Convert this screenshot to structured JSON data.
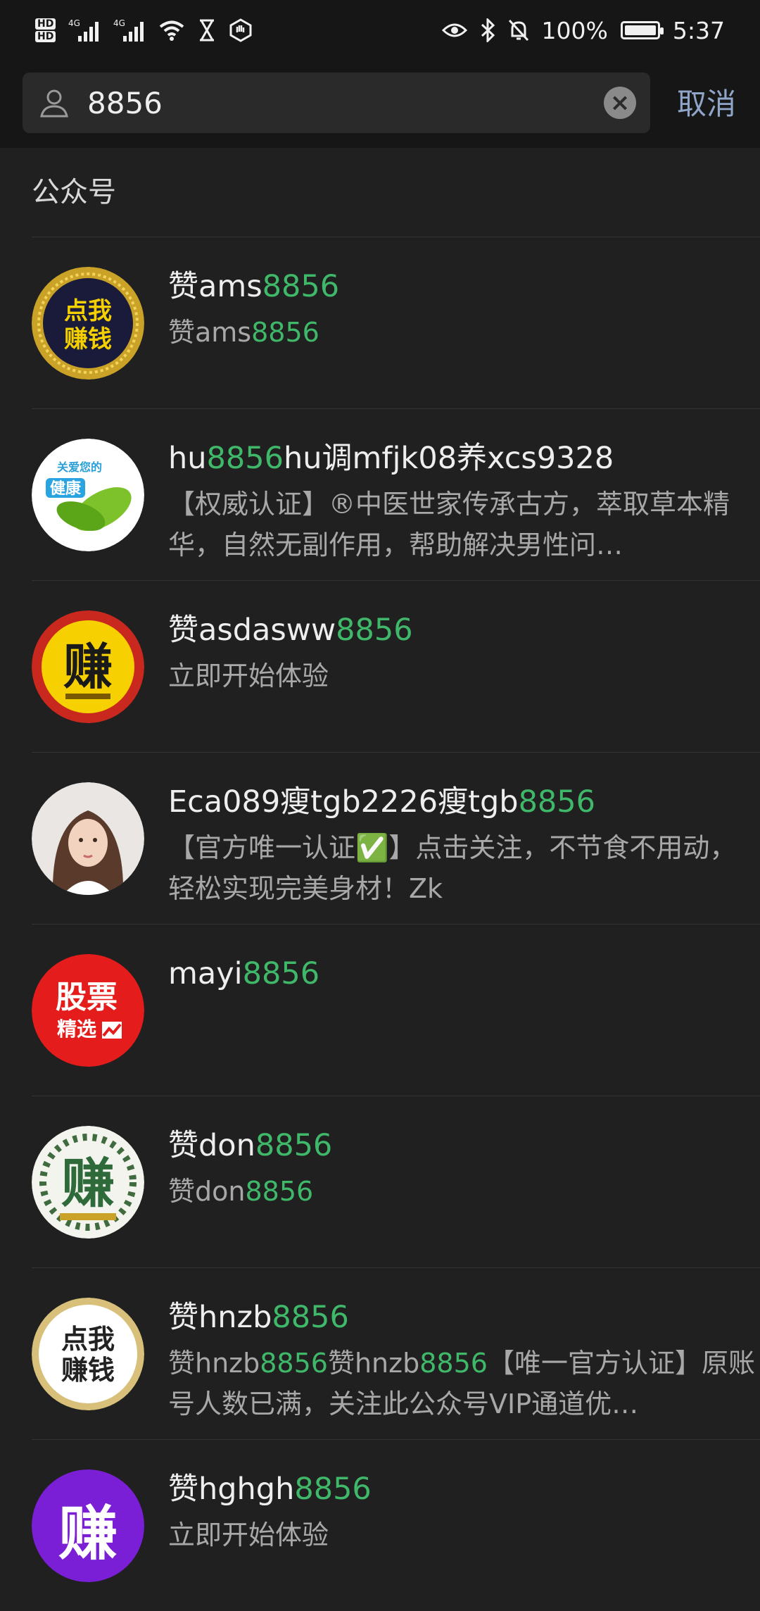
{
  "status_bar": {
    "hd1": "HD",
    "hd2": "HD",
    "net1": "4G",
    "net2": "4G",
    "battery_text": "100%",
    "battery_level": 100,
    "time": "5:37"
  },
  "search": {
    "query": "8856",
    "cancel_label": "取消"
  },
  "section_title": "公众号",
  "highlight_color": "#3fb86a",
  "results": [
    {
      "title_prefix": "赞ams",
      "title_match": "8856",
      "title_suffix": "",
      "desc_parts": [
        [
          "赞ams",
          false
        ],
        [
          "8856",
          true
        ]
      ]
    },
    {
      "title_prefix": "hu",
      "title_match": "8856",
      "title_suffix": "hu调mfjk08养xcs9328",
      "desc_parts": [
        [
          "【权威认证】®中医世家传承古方，萃取草本精华，自然无副作用，帮助解决男性问…",
          false
        ]
      ]
    },
    {
      "title_prefix": "赞asdasww",
      "title_match": "8856",
      "title_suffix": "",
      "desc_parts": [
        [
          "立即开始体验",
          false
        ]
      ]
    },
    {
      "title_prefix": "Eca089瘦tgb2226瘦tgb",
      "title_match": "8856",
      "title_suffix": "",
      "desc_parts": [
        [
          "【官方唯一认证✅】点击关注，不节食不用动，轻松实现完美身材！Zk",
          false
        ]
      ]
    },
    {
      "title_prefix": "mayi",
      "title_match": "8856",
      "title_suffix": "",
      "desc_parts": []
    },
    {
      "title_prefix": "赞don",
      "title_match": "8856",
      "title_suffix": "",
      "desc_parts": [
        [
          "赞don",
          false
        ],
        [
          "8856",
          true
        ]
      ]
    },
    {
      "title_prefix": "赞hnzb",
      "title_match": "8856",
      "title_suffix": "",
      "desc_parts": [
        [
          "赞hnzb",
          false
        ],
        [
          "8856",
          true
        ],
        [
          "赞hnzb",
          false
        ],
        [
          "8856",
          true
        ],
        [
          "【唯一官方认证】原账号人数已满，关注此公众号VIP通道优…",
          false
        ]
      ]
    },
    {
      "title_prefix": "赞hghgh",
      "title_match": "8856",
      "title_suffix": "",
      "desc_parts": [
        [
          "立即开始体验",
          false
        ]
      ]
    }
  ],
  "avatars": [
    {
      "icon": "gold-seal-avatar",
      "text": [
        "点我",
        "赚钱"
      ]
    },
    {
      "icon": "health-leaf-avatar",
      "text": [
        "关爱您的",
        "健康"
      ]
    },
    {
      "icon": "yellow-coin-avatar",
      "text": [
        "赚"
      ]
    },
    {
      "icon": "girl-photo-avatar",
      "text": []
    },
    {
      "icon": "stock-avatar",
      "text": [
        "股票",
        "精选"
      ]
    },
    {
      "icon": "wreath-avatar",
      "text": [
        "赚"
      ]
    },
    {
      "icon": "coin-plate-avatar",
      "text": [
        "点我",
        "赚钱"
      ]
    },
    {
      "icon": "purple-avatar",
      "text": [
        "赚"
      ]
    }
  ]
}
